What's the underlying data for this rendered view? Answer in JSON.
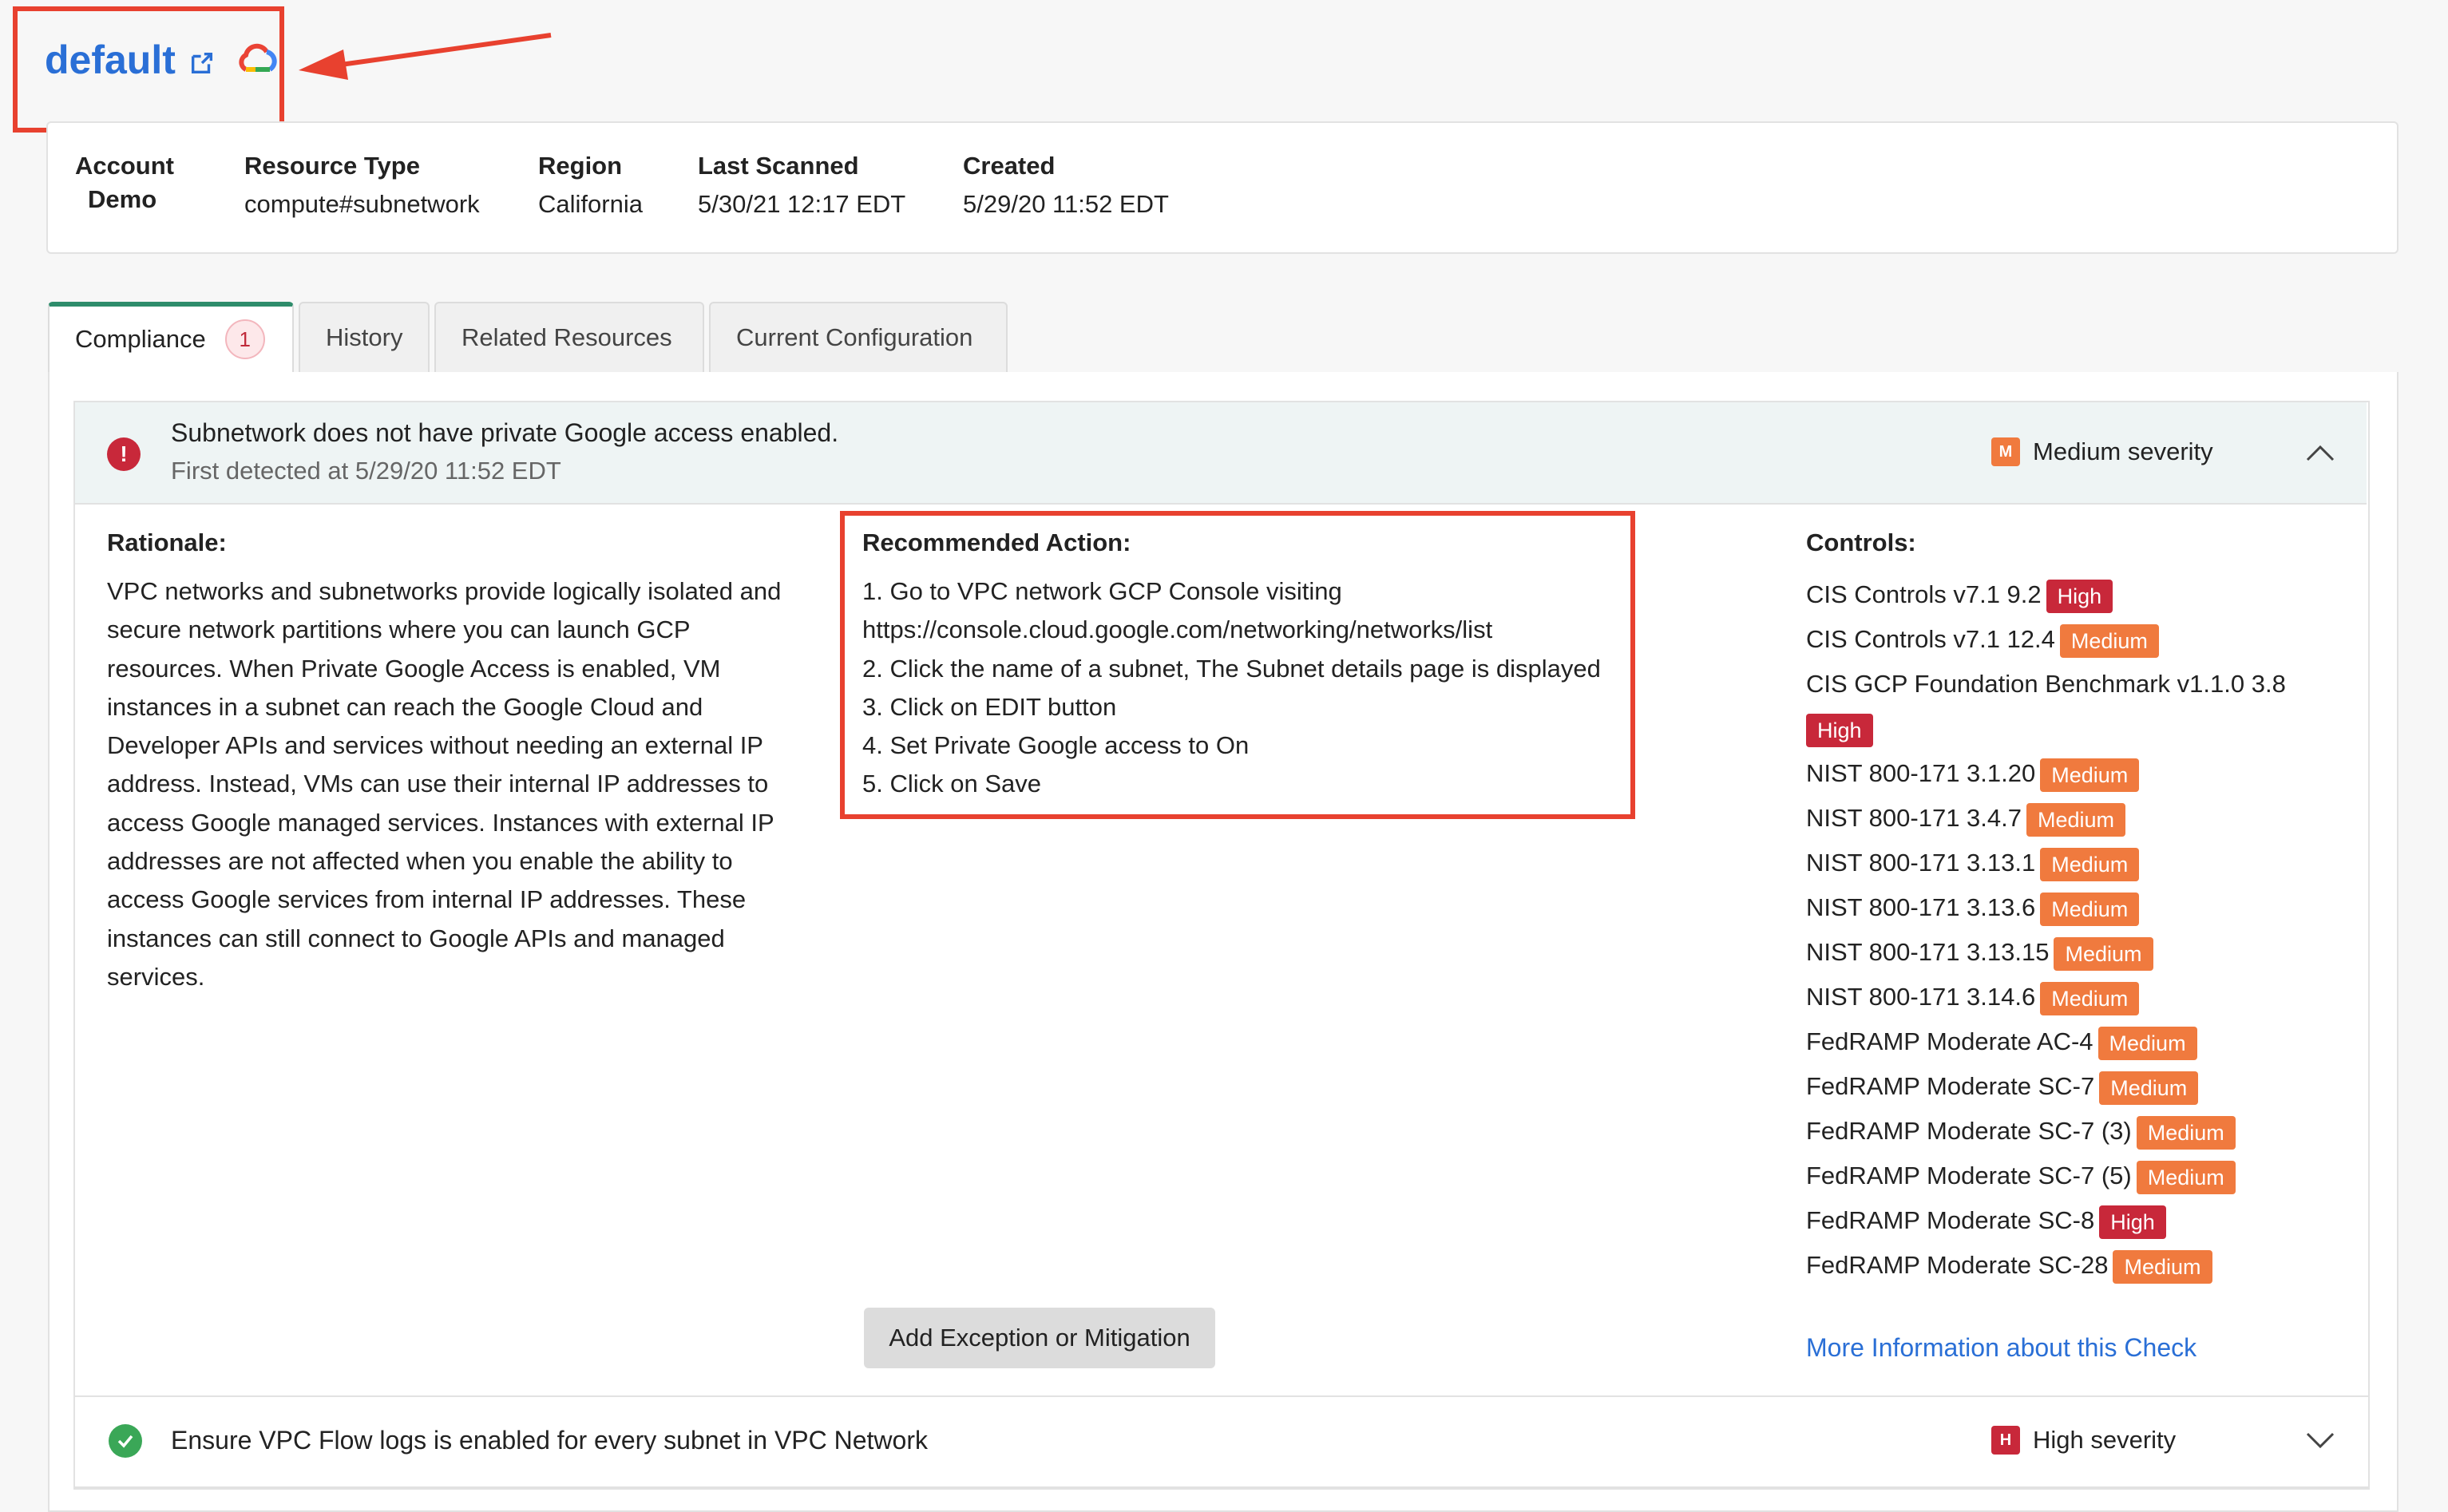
{
  "resource": {
    "title": "default"
  },
  "info": {
    "account_label": "Account",
    "account_value": "Demo",
    "resource_type_label": "Resource Type",
    "resource_type_value": "compute#subnetwork",
    "region_label": "Region",
    "region_value": "California",
    "last_scanned_label": "Last Scanned",
    "last_scanned_value": "5/30/21 12:17 EDT",
    "created_label": "Created",
    "created_value": "5/29/20 11:52 EDT"
  },
  "tabs": {
    "compliance": "Compliance",
    "compliance_count": "1",
    "history": "History",
    "related": "Related Resources",
    "config": "Current Configuration"
  },
  "check1": {
    "icon_glyph": "!",
    "title": "Subnetwork does not have private Google access enabled.",
    "subtitle": "First detected at 5/29/20 11:52 EDT",
    "severity_letter": "M",
    "severity_text": "Medium severity",
    "rationale_title": "Rationale:",
    "rationale_lines": [
      "VPC networks and subnetworks provide logically isolated and",
      "secure network partitions where you can launch GCP",
      "resources. When Private Google Access is enabled, VM",
      "instances in a subnet can reach the Google Cloud and",
      "Developer APIs and services without needing an external IP",
      "address. Instead, VMs can use their internal IP addresses to",
      "access Google managed services. Instances with external IP",
      "addresses are not affected when you enable the ability to",
      "access Google services from internal IP addresses. These",
      "instances can still connect to Google APIs and managed",
      "services."
    ],
    "recommended_title": "Recommended Action:",
    "recommended_lines": [
      "1. Go to VPC network GCP Console visiting",
      "https://console.cloud.google.com/networking/networks/list",
      "2. Click the name of a subnet, The Subnet details page is displayed",
      "3. Click on EDIT button",
      "4. Set Private Google access to On",
      "5. Click on Save"
    ],
    "controls_title": "Controls:",
    "controls": [
      {
        "name": "CIS Controls v7.1 9.2",
        "level": "High"
      },
      {
        "name": "CIS Controls v7.1 12.4",
        "level": "Medium"
      },
      {
        "name": "CIS GCP Foundation Benchmark v1.1.0 3.8",
        "level": "High"
      },
      {
        "name": "NIST 800-171 3.1.20",
        "level": "Medium"
      },
      {
        "name": "NIST 800-171 3.4.7",
        "level": "Medium"
      },
      {
        "name": "NIST 800-171 3.13.1",
        "level": "Medium"
      },
      {
        "name": "NIST 800-171 3.13.6",
        "level": "Medium"
      },
      {
        "name": "NIST 800-171 3.13.15",
        "level": "Medium"
      },
      {
        "name": "NIST 800-171 3.14.6",
        "level": "Medium"
      },
      {
        "name": "FedRAMP Moderate AC-4",
        "level": "Medium"
      },
      {
        "name": "FedRAMP Moderate SC-7",
        "level": "Medium"
      },
      {
        "name": "FedRAMP Moderate SC-7 (3)",
        "level": "Medium"
      },
      {
        "name": "FedRAMP Moderate SC-7 (5)",
        "level": "Medium"
      },
      {
        "name": "FedRAMP Moderate SC-8",
        "level": "High"
      },
      {
        "name": "FedRAMP Moderate SC-28",
        "level": "Medium"
      }
    ],
    "exception_button": "Add Exception or Mitigation",
    "more_info_link": "More Information about this Check"
  },
  "check2": {
    "title": "Ensure VPC Flow logs is enabled for every subnet in VPC Network",
    "severity_letter": "H",
    "severity_text": "High severity"
  },
  "colors": {
    "link_blue": "#2a6fd6",
    "high": "#c8283a",
    "medium": "#f07a3e",
    "annotation_red": "#e8412f",
    "active_tab_green": "#2e8c6b"
  },
  "icons": {
    "external_link": "external-link-icon",
    "gcp_logo": "google-cloud-logo",
    "error": "exclamation-circle-icon",
    "success": "check-circle-icon",
    "collapse": "chevron-up-icon",
    "expand": "chevron-down-icon"
  }
}
